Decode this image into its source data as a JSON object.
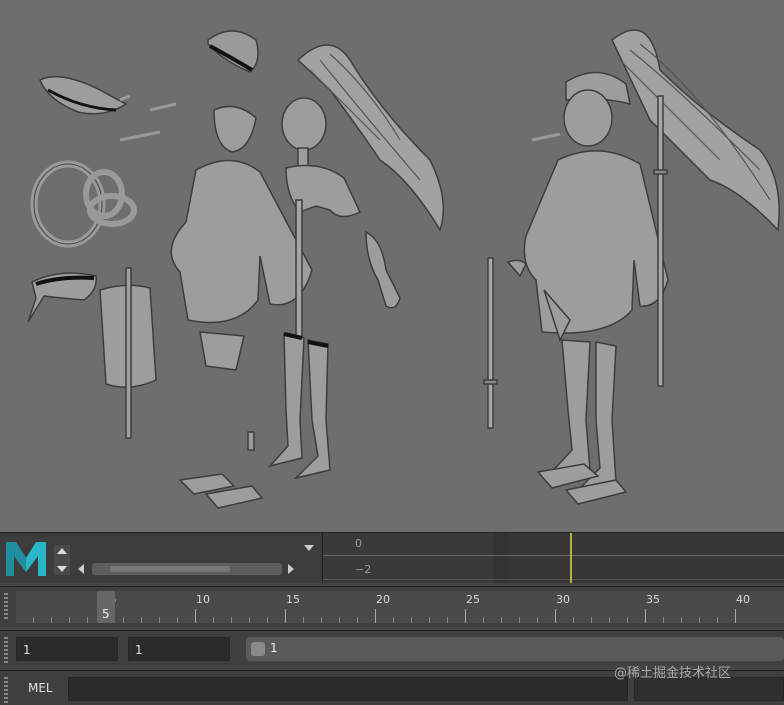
{
  "app": {
    "name": "Maya",
    "logo_letter": "M",
    "brand_color": "#28b6c8"
  },
  "graph_editor": {
    "value_labels": [
      "0",
      "−2"
    ]
  },
  "timeline": {
    "current_frame": "5",
    "tick_labels": [
      "5",
      "10",
      "15",
      "20",
      "25",
      "30",
      "35",
      "40"
    ]
  },
  "range": {
    "start": "1",
    "playback_start": "1",
    "slider_label": "1"
  },
  "command_line": {
    "language_label": "MEL"
  },
  "watermark": "@稀土掘金技术社区"
}
